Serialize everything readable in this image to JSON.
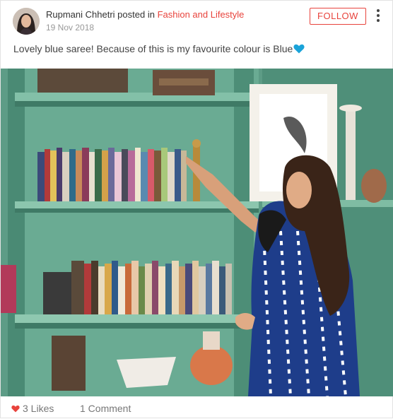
{
  "post": {
    "author": "Rupmani Chhetri",
    "posted_in_text": "posted in",
    "category": "Fashion and Lifestyle",
    "date": "19 Nov 2018",
    "follow_label": "FOLLOW",
    "caption": "Lovely blue saree! Because of this is my favourite colour is Blue",
    "caption_emoji": "blue-heart-icon"
  },
  "footer": {
    "likes": "3 Likes",
    "comments": "1 Comment"
  },
  "colors": {
    "accent": "#e8433c",
    "heart_blue": "#1aa3d9",
    "like_heart": "#e8433c"
  }
}
